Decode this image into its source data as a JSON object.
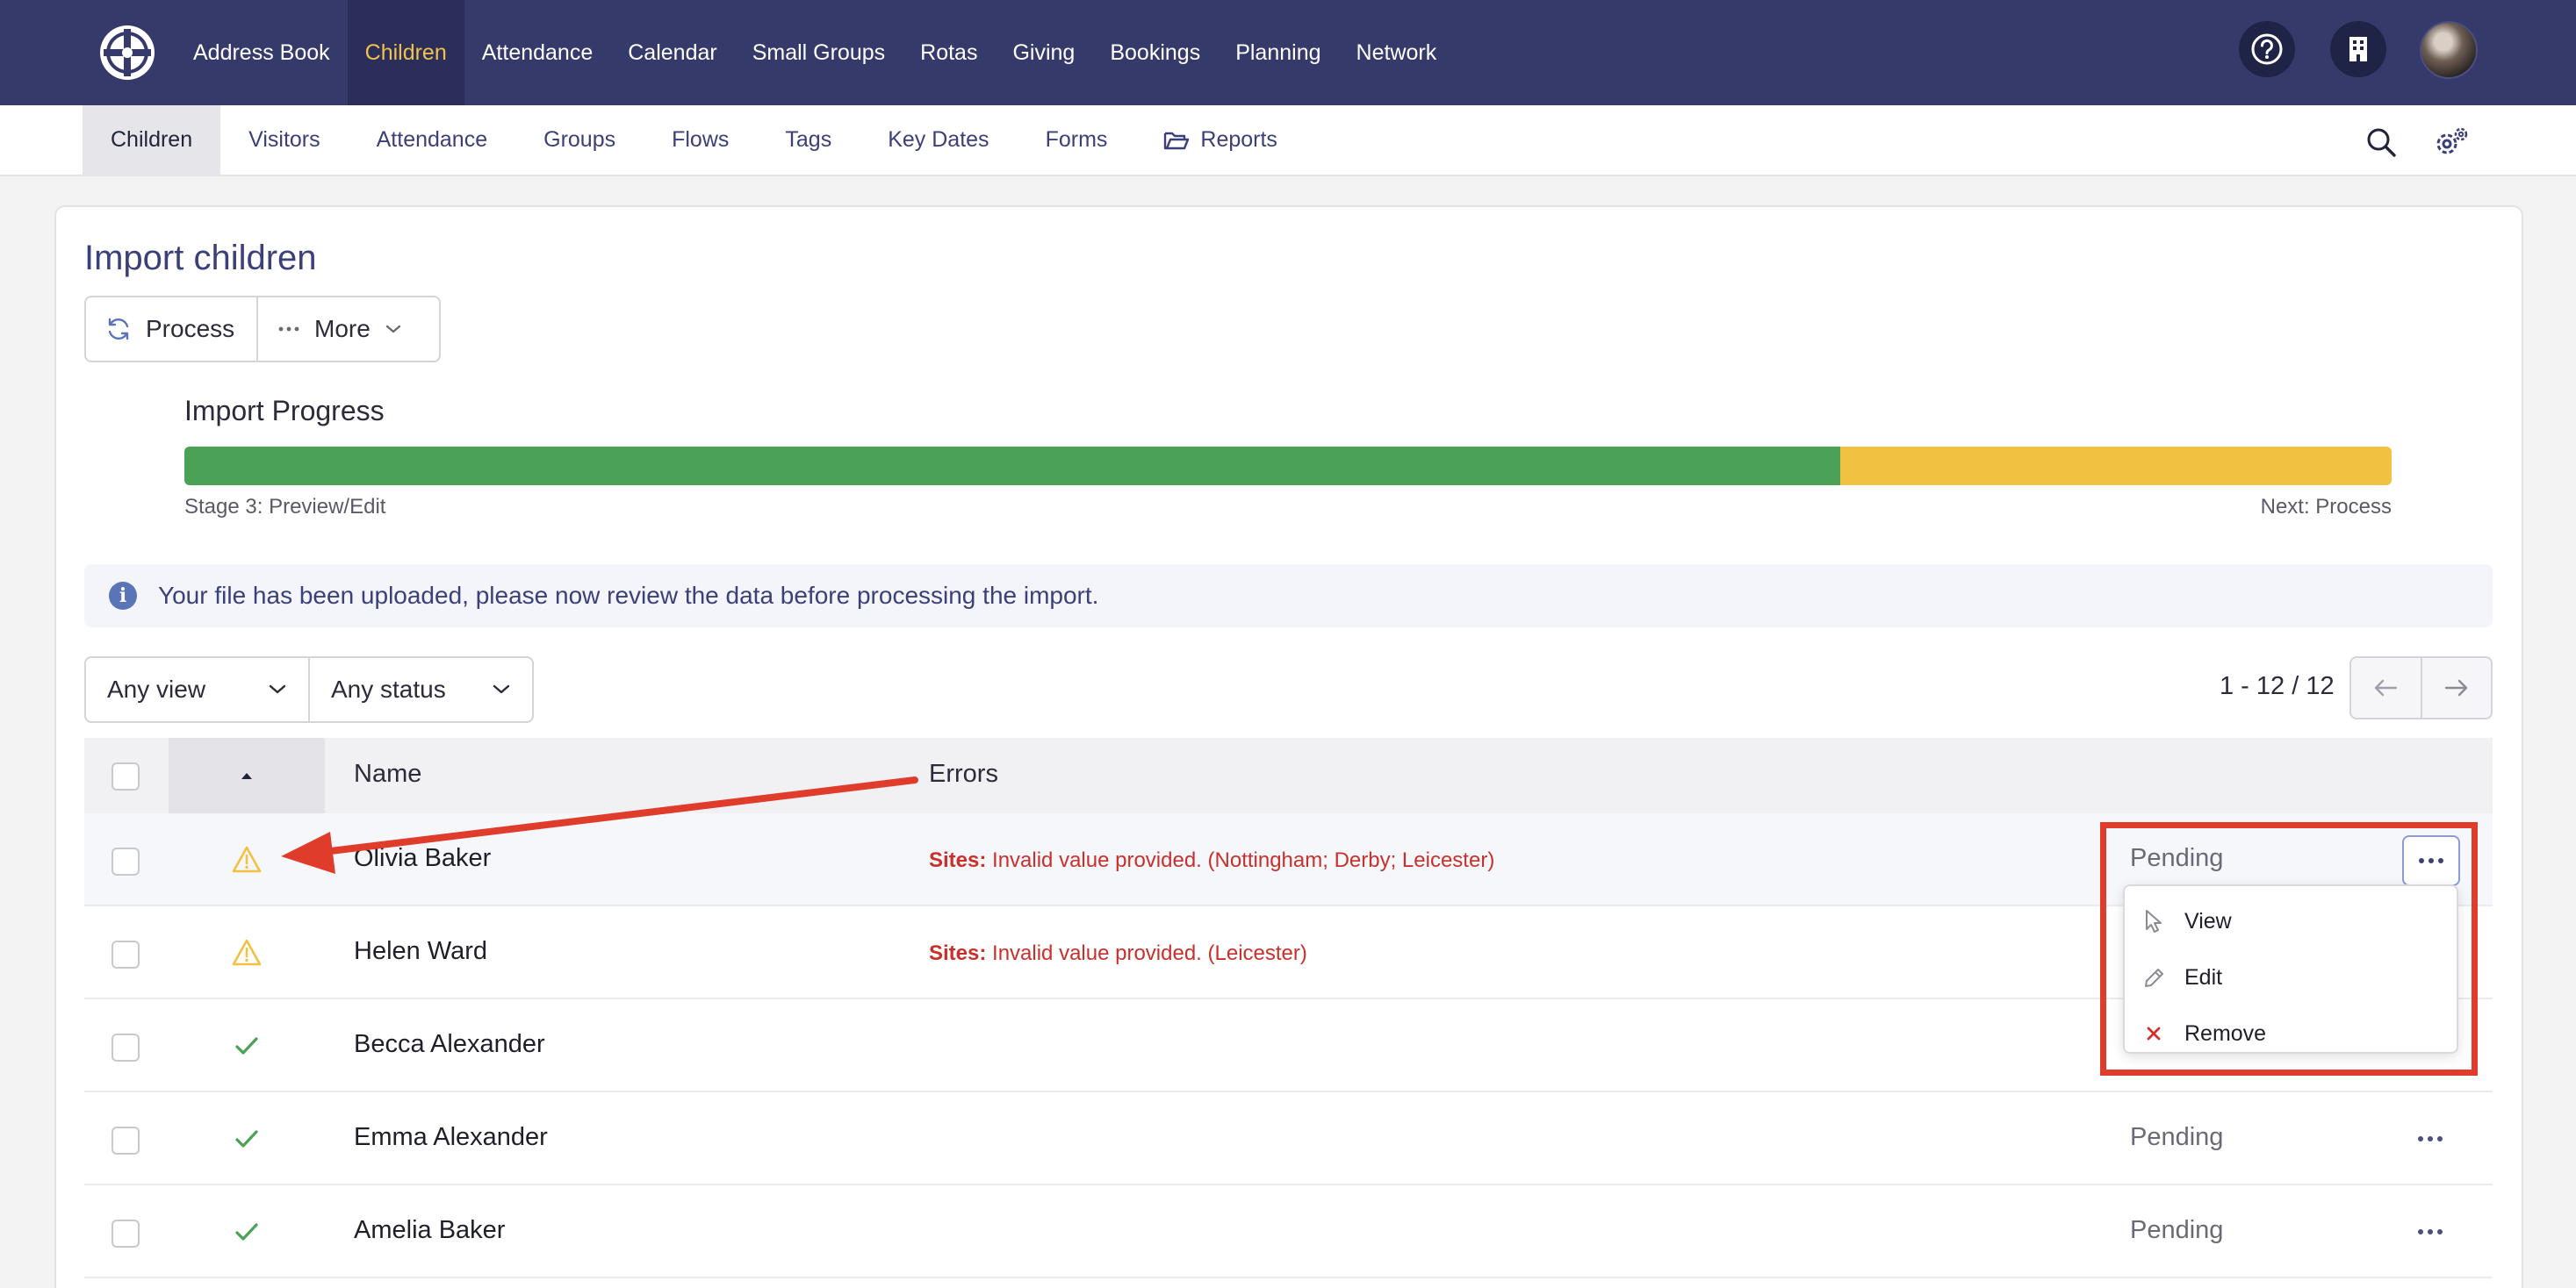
{
  "topnav": {
    "items": [
      {
        "label": "Address Book",
        "active": false
      },
      {
        "label": "Children",
        "active": true
      },
      {
        "label": "Attendance",
        "active": false
      },
      {
        "label": "Calendar",
        "active": false
      },
      {
        "label": "Small Groups",
        "active": false
      },
      {
        "label": "Rotas",
        "active": false
      },
      {
        "label": "Giving",
        "active": false
      },
      {
        "label": "Bookings",
        "active": false
      },
      {
        "label": "Planning",
        "active": false
      },
      {
        "label": "Network",
        "active": false
      }
    ],
    "help_icon": "question-circle-icon",
    "org_icon": "building-icon"
  },
  "subnav": {
    "items": [
      {
        "label": "Children",
        "active": true
      },
      {
        "label": "Visitors",
        "active": false
      },
      {
        "label": "Attendance",
        "active": false
      },
      {
        "label": "Groups",
        "active": false
      },
      {
        "label": "Flows",
        "active": false
      },
      {
        "label": "Tags",
        "active": false
      },
      {
        "label": "Key Dates",
        "active": false
      },
      {
        "label": "Forms",
        "active": false
      },
      {
        "label": "Reports",
        "active": false
      }
    ]
  },
  "page": {
    "title": "Import children",
    "process_label": "Process",
    "more_label": "More"
  },
  "progress": {
    "label": "Import Progress",
    "stage": "Stage 3: Preview/Edit",
    "next": "Next: Process",
    "complete_fraction": 0.75,
    "complete_color": "#4ba257",
    "remaining_color": "#f1c142"
  },
  "info": {
    "message": "Your file has been uploaded, please now review the data before processing the import."
  },
  "filters": {
    "view": "Any view",
    "status": "Any status"
  },
  "pagination": {
    "range": "1 - 12",
    "total": " / 12"
  },
  "table": {
    "headers": {
      "name": "Name",
      "errors": "Errors"
    },
    "rows": [
      {
        "status_icon": "warning-icon",
        "name": "Olivia Baker",
        "error_label": "Sites:",
        "error_text": "Invalid value provided. (Nottingham; Derby; Leicester)",
        "status": "Pending"
      },
      {
        "status_icon": "warning-icon",
        "name": "Helen Ward",
        "error_label": "Sites:",
        "error_text": "Invalid value provided. (Leicester)",
        "status": ""
      },
      {
        "status_icon": "check-icon",
        "name": "Becca Alexander",
        "error_label": "",
        "error_text": "",
        "status": ""
      },
      {
        "status_icon": "check-icon",
        "name": "Emma Alexander",
        "error_label": "",
        "error_text": "",
        "status": "Pending"
      },
      {
        "status_icon": "check-icon",
        "name": "Amelia Baker",
        "error_label": "",
        "error_text": "",
        "status": "Pending"
      }
    ]
  },
  "row_menu": {
    "items": [
      {
        "label": "View",
        "icon": "pointer-icon"
      },
      {
        "label": "Edit",
        "icon": "pencil-icon"
      },
      {
        "label": "Remove",
        "icon": "close-icon"
      }
    ]
  },
  "colors": {
    "nav_bg": "#353a6b",
    "accent": "#f1c24d",
    "error": "#c9302c",
    "annotation": "#e03c2b"
  }
}
